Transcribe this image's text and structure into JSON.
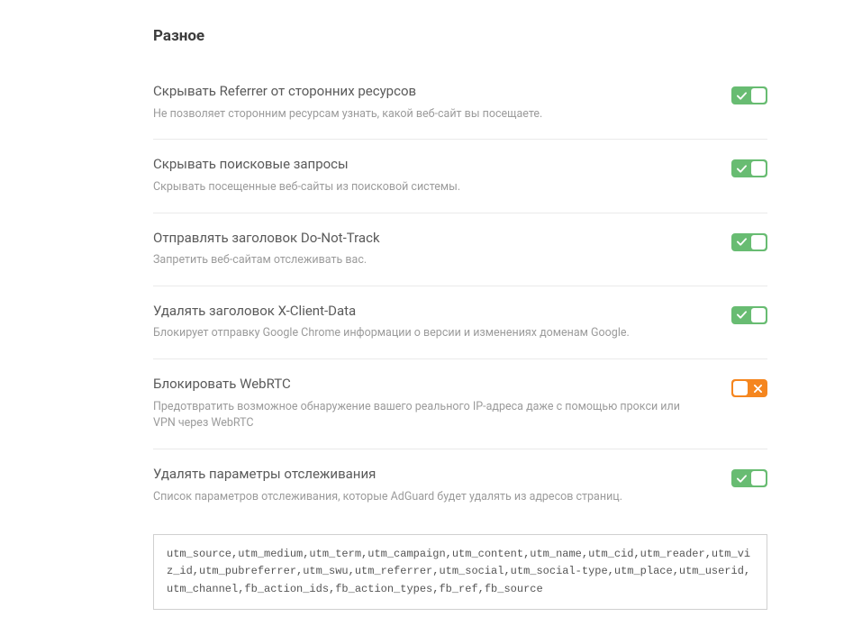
{
  "section_title": "Разное",
  "settings": [
    {
      "label": "Скрывать Referrer от сторонних ресурсов",
      "desc": "Не позволяет сторонним ресурсам узнать, какой веб-сайт вы посещаете.",
      "enabled": true
    },
    {
      "label": "Скрывать поисковые запросы",
      "desc": "Скрывать посещенные веб-сайты из поисковой системы.",
      "enabled": true
    },
    {
      "label": "Отправлять заголовок Do-Not-Track",
      "desc": "Запретить веб-сайтам отслеживать вас.",
      "enabled": true
    },
    {
      "label": "Удалять заголовок X-Client-Data",
      "desc": "Блокирует отправку Google Chrome информации о версии и изменениях доменам Google.",
      "enabled": true
    },
    {
      "label": "Блокировать WebRTC",
      "desc": "Предотвратить возможное обнаружение вашего реального IP-адреса даже с помощью прокси или VPN через WebRTC",
      "enabled": false
    },
    {
      "label": "Удалять параметры отслеживания",
      "desc": "Список параметров отслеживания, которые AdGuard будет удалять из адресов страниц.",
      "enabled": true
    }
  ],
  "tracking_params": "utm_source,utm_medium,utm_term,utm_campaign,utm_content,utm_name,utm_cid,utm_reader,utm_viz_id,utm_pubreferrer,utm_swu,utm_referrer,utm_social,utm_social-type,utm_place,utm_userid,utm_channel,fb_action_ids,fb_action_types,fb_ref,fb_source"
}
